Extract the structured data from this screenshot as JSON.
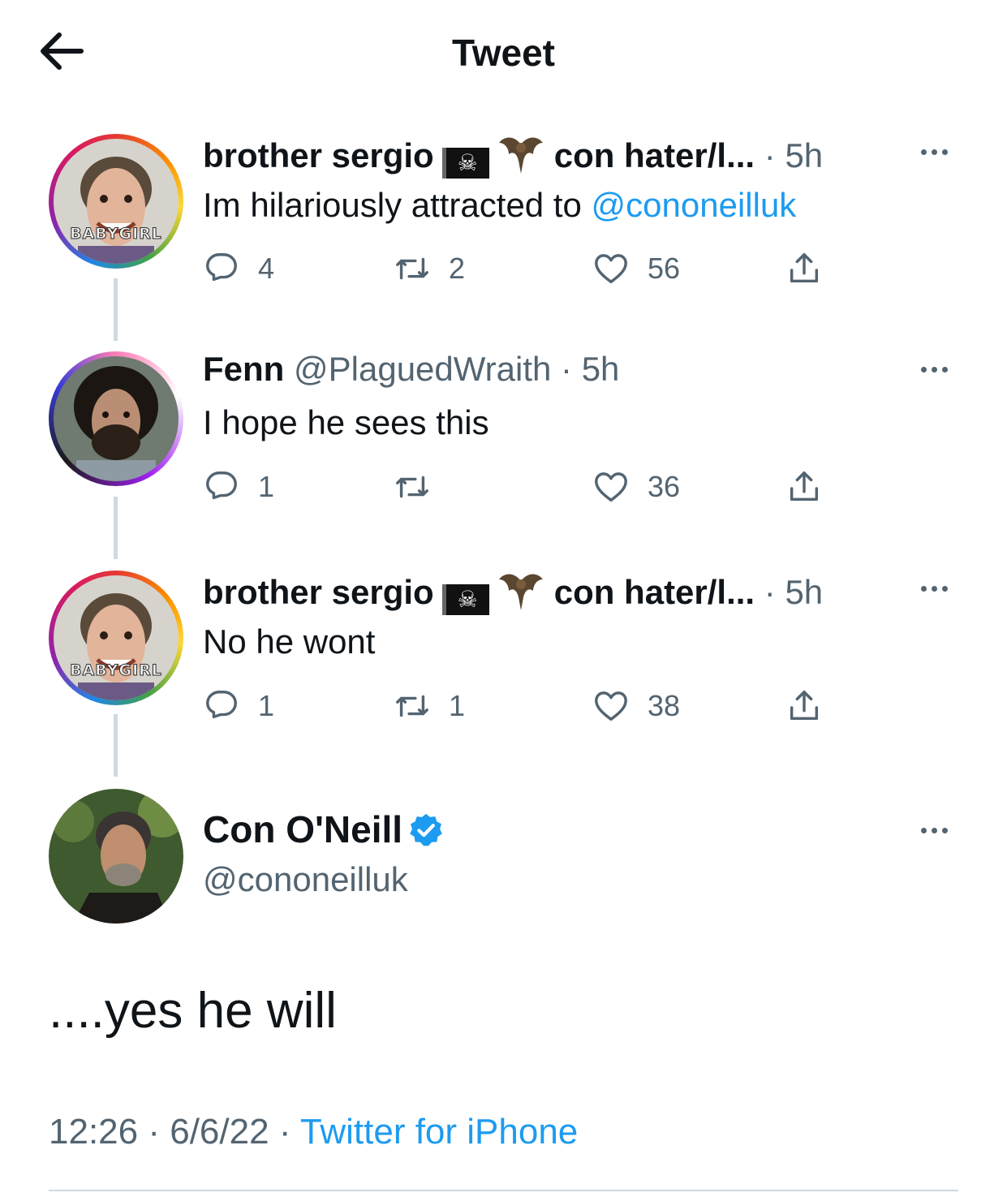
{
  "header": {
    "title": "Tweet"
  },
  "tweets": [
    {
      "name": "brother sergio",
      "name_extra": "con hater/l...",
      "time": "5h",
      "avatar_badge": "BABYGIRL",
      "text": "Im hilariously attracted to ",
      "mention": "@cononeilluk",
      "replies": "4",
      "retweets": "2",
      "likes": "56"
    },
    {
      "name": "Fenn",
      "handle": "@PlaguedWraith",
      "time": "5h",
      "text": "I hope he sees this",
      "replies": "1",
      "retweets": "",
      "likes": "36"
    },
    {
      "name": "brother sergio",
      "name_extra": "con hater/l...",
      "time": "5h",
      "avatar_badge": "BABYGIRL",
      "text": "No he wont",
      "replies": "1",
      "retweets": "1",
      "likes": "38"
    }
  ],
  "main_tweet": {
    "name": "Con O'Neill",
    "handle": "@cononeilluk",
    "text": "....yes he will",
    "time": "12:26",
    "date": "6/6/22",
    "source": "Twitter for iPhone"
  },
  "colors": {
    "link": "#1d9bf0",
    "secondary": "#536471",
    "line": "#cfd9de"
  }
}
